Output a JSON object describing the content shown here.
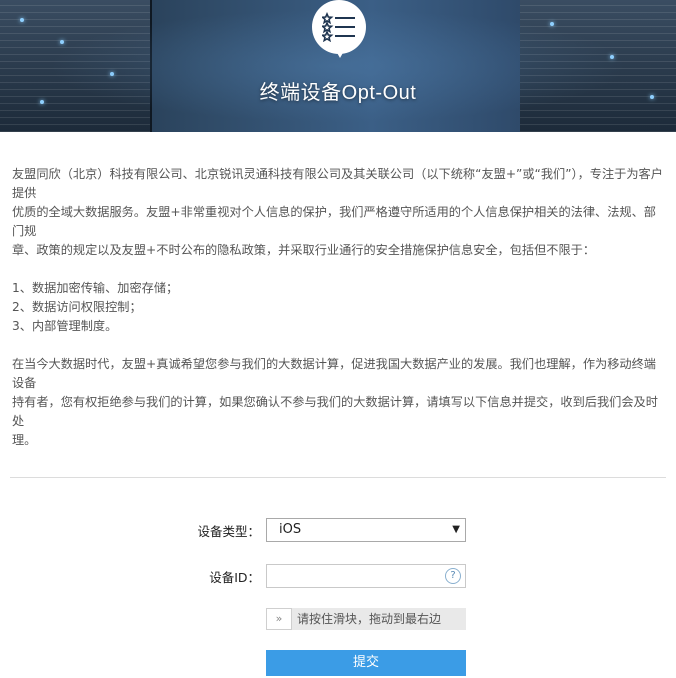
{
  "header": {
    "title": "终端设备Opt-Out",
    "logo_icon": "star-list-icon"
  },
  "intro": {
    "lines": [
      "友盟同欣（北京）科技有限公司、北京锐讯灵通科技有限公司及其关联公司（以下统称“友盟+”或“我们”），专注于为客户提供",
      "优质的全域大数据服务。友盟+非常重视对个人信息的保护，我们严格遵守所适用的个人信息保护相关的法律、法规、部门规",
      "章、政策的规定以及友盟+不时公布的隐私政策，并采取行业通行的安全措施保护信息安全，包括但不限于："
    ]
  },
  "measures": {
    "items": [
      "1、数据加密传输、加密存储；",
      "2、数据访问权限控制；",
      "3、内部管理制度。"
    ]
  },
  "summary": {
    "lines": [
      "在当今大数据时代，友盟+真诚希望您参与我们的大数据计算，促进我国大数据产业的发展。我们也理解，作为移动终端设备",
      "持有者，您有权拒绝参与我们的计算，如果您确认不参与我们的大数据计算，请填写以下信息并提交，收到后我们会及时处",
      "理。"
    ]
  },
  "form": {
    "device_type_label": "设备类型：",
    "device_type_value": "iOS",
    "device_type_arrow": "▼",
    "device_id_label": "设备ID：",
    "device_id_value": "",
    "help_icon": "question-circle-icon",
    "help_glyph": "?",
    "slider_handle_glyph": "»",
    "slider_text": "请按住滑块，拖动到最右边",
    "submit_label": "提交"
  },
  "colors": {
    "submit_bg": "#3b9ce6",
    "banner_dark": "#1d2d3e",
    "text": "#555555"
  }
}
